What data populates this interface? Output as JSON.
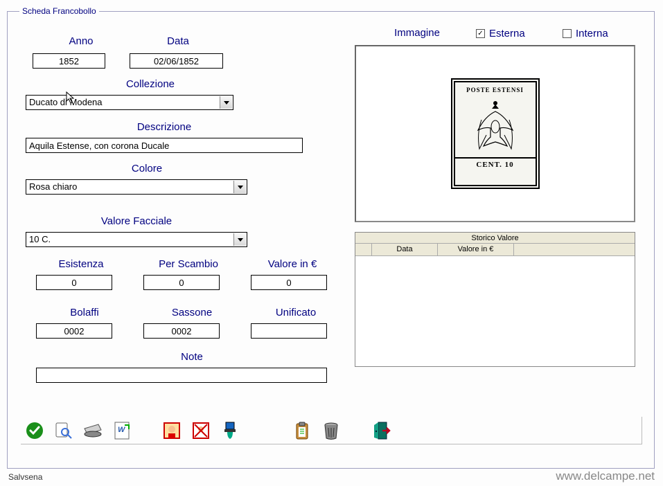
{
  "window": {
    "legend": "Scheda Francobollo"
  },
  "labels": {
    "anno": "Anno",
    "data": "Data",
    "collezione": "Collezione",
    "descrizione": "Descrizione",
    "colore": "Colore",
    "valoreFacciale": "Valore Facciale",
    "esistenza": "Esistenza",
    "perScambio": "Per Scambio",
    "valoreEuro": "Valore in €",
    "bolaffi": "Bolaffi",
    "sassone": "Sassone",
    "unificato": "Unificato",
    "note": "Note",
    "immagine": "Immagine",
    "esterna": "Esterna",
    "interna": "Interna"
  },
  "values": {
    "anno": "1852",
    "data": "02/06/1852",
    "collezione": "Ducato di Modena",
    "descrizione": "Aquila Estense, con corona Ducale",
    "colore": "Rosa chiaro",
    "valoreFacciale": "10 C.",
    "esistenza": "0",
    "perScambio": "0",
    "valoreEuro": "0",
    "bolaffi": "0002",
    "sassone": "0002",
    "unificato": "",
    "note": "",
    "esternaChecked": true,
    "internaChecked": false
  },
  "stamp": {
    "top": "POSTE ESTENSI",
    "denom": "CENT.  10"
  },
  "grid": {
    "title": "Storico Valore",
    "cols": [
      "Data",
      "Valore in €"
    ]
  },
  "footer": {
    "left": "Salvsena",
    "right": "www.delcampe.net"
  }
}
